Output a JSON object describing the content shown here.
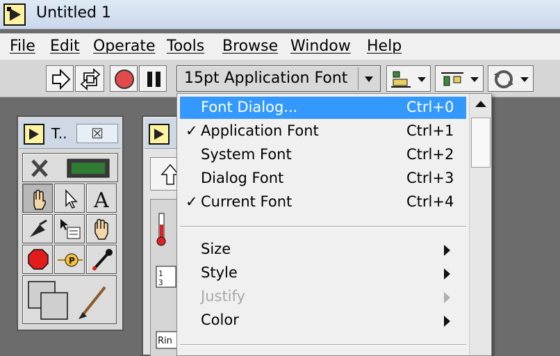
{
  "window": {
    "title": "Untitled 1",
    "icon": "labview-run-icon"
  },
  "menubar": {
    "items": [
      {
        "label": "File"
      },
      {
        "label": "Edit"
      },
      {
        "label": "Operate"
      },
      {
        "label": "Tools"
      },
      {
        "label": "Browse"
      },
      {
        "label": "Window"
      },
      {
        "label": "Help"
      }
    ]
  },
  "toolbar": {
    "buttons": [
      "run-arrow-icon",
      "run-continuously-icon",
      "abort-icon",
      "pause-icon"
    ],
    "font_select": {
      "value": "15pt Application Font"
    },
    "right_buttons": [
      "align-objects-icon",
      "distribute-objects-icon",
      "reorder-icon"
    ],
    "colors": {
      "abort_red": "#e34b4b",
      "highlight": "#3399ff"
    }
  },
  "tools_palette": {
    "title": "T..",
    "close_label": "☒",
    "tools": [
      "automatic-tool-icon",
      "operate-value-icon",
      "position-select-icon",
      "edit-text-icon",
      "connect-wire-icon",
      "object-shortcut-menu-icon",
      "scroll-window-icon",
      "breakpoint-icon",
      "probe-icon",
      "color-copy-icon",
      "set-color-icon"
    ]
  },
  "font_menu": {
    "items": [
      {
        "label": "Font Dialog...",
        "shortcut": "Ctrl+0",
        "checked": "",
        "highlight": true
      },
      {
        "label": "Application Font",
        "shortcut": "Ctrl+1",
        "checked": "✓"
      },
      {
        "label": "System Font",
        "shortcut": "Ctrl+2",
        "checked": ""
      },
      {
        "label": "Dialog Font",
        "shortcut": "Ctrl+3",
        "checked": ""
      },
      {
        "label": "Current Font",
        "shortcut": "Ctrl+4",
        "checked": "✓"
      }
    ],
    "sub_items": [
      {
        "label": "Size",
        "enabled": true
      },
      {
        "label": "Style",
        "enabled": true
      },
      {
        "label": "Justify",
        "enabled": false
      },
      {
        "label": "Color",
        "enabled": true
      }
    ]
  }
}
